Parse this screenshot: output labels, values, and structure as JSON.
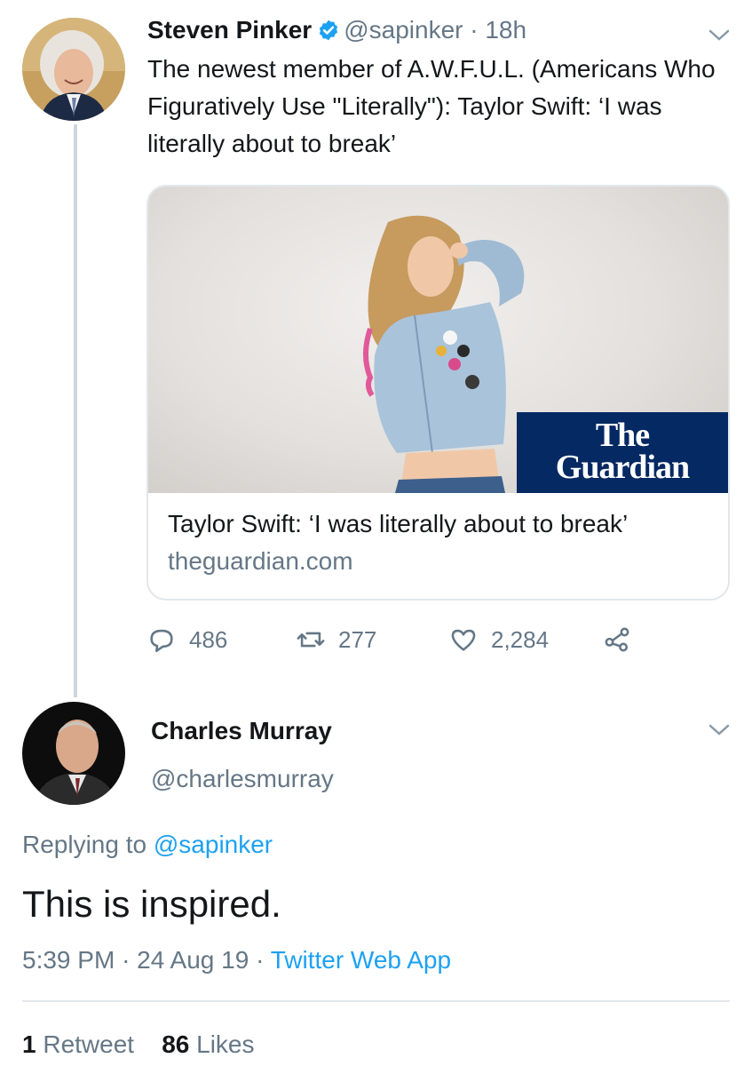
{
  "tweet1": {
    "name": "Steven Pinker",
    "handle": "@sapinker",
    "separator": "·",
    "time": "18h",
    "text": "The newest member of A.W.F.U.L. (Americans Who Figuratively Use \"Literally\"): Taylor Swift: ‘I was literally about to break’",
    "card": {
      "logo_line1": "The",
      "logo_line2": "Guardian",
      "title": "Taylor Swift: ‘I was literally about to break’",
      "domain": "theguardian.com"
    },
    "actions": {
      "replies": "486",
      "retweets": "277",
      "likes": "2,284"
    }
  },
  "tweet2": {
    "name": "Charles Murray",
    "handle": "@charlesmurray",
    "replying_prefix": "Replying to",
    "replying_handle": "@sapinker",
    "text": "This is inspired.",
    "time": "5:39 PM",
    "sep1": "·",
    "date": "24 Aug 19",
    "sep2": "·",
    "source": "Twitter Web App",
    "retweet_count": "1",
    "retweet_label": "Retweet",
    "like_count": "86",
    "like_label": "Likes"
  },
  "colors": {
    "verified": "#1da1f2",
    "link": "#1da1f2",
    "muted": "#657786",
    "guardian": "#052962"
  },
  "icons": [
    "verified-icon",
    "chevron-down-icon",
    "reply-icon",
    "retweet-icon",
    "like-icon",
    "share-icon"
  ]
}
